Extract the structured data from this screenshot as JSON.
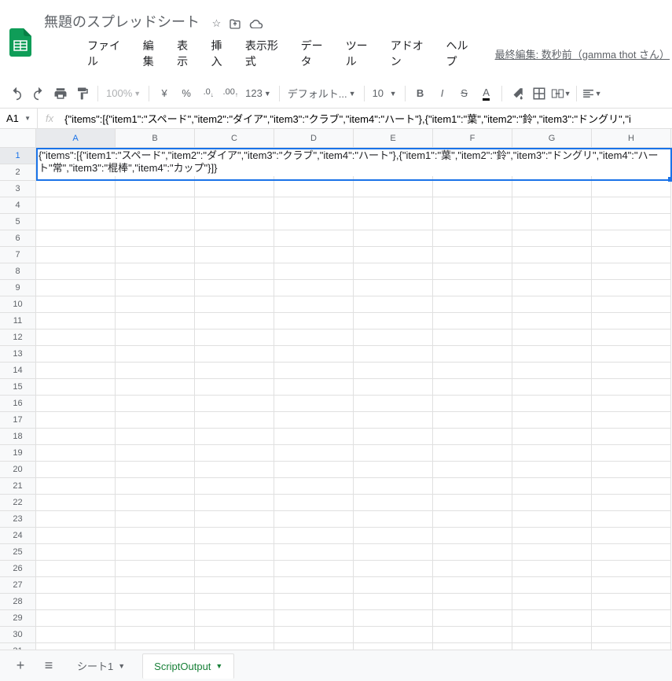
{
  "doc_title": "無題のスプレッドシート",
  "menu": {
    "file": "ファイル",
    "edit": "編集",
    "view": "表示",
    "insert": "挿入",
    "format": "表示形式",
    "data": "データ",
    "tools": "ツール",
    "addons": "アドオン",
    "help": "ヘルプ"
  },
  "last_edit": "最終編集: 数秒前（gamma thot さん）",
  "toolbar": {
    "zoom": "100%",
    "currency": "¥",
    "percent": "%",
    "dec_dec": ".0",
    "inc_dec": ".00",
    "num_format": "123",
    "font": "デフォルト...",
    "font_size": "10"
  },
  "name_box": "A1",
  "formula": "{\"items\":[{\"item1\":\"スペード\",\"item2\":\"ダイア\",\"item3\":\"クラブ\",\"item4\":\"ハート\"},{\"item1\":\"葉\",\"item2\":\"鈴\",\"item3\":\"ドングリ\",\"i",
  "cell_overflow": "{\"items\":[{\"item1\":\"スペード\",\"item2\":\"ダイア\",\"item3\":\"クラブ\",\"item4\":\"ハート\"},{\"item1\":\"葉\",\"item2\":\"鈴\",\"item3\":\"ドングリ\",\"item4\":\"ハート\"常\",\"item3\":\"棍棒\",\"item4\":\"カップ\"}]}",
  "columns": [
    "A",
    "B",
    "C",
    "D",
    "E",
    "F",
    "G",
    "H"
  ],
  "row_count": 31,
  "sheets": {
    "add": "+",
    "menu": "≡",
    "tab1": "シート1",
    "tab2": "ScriptOutput"
  }
}
